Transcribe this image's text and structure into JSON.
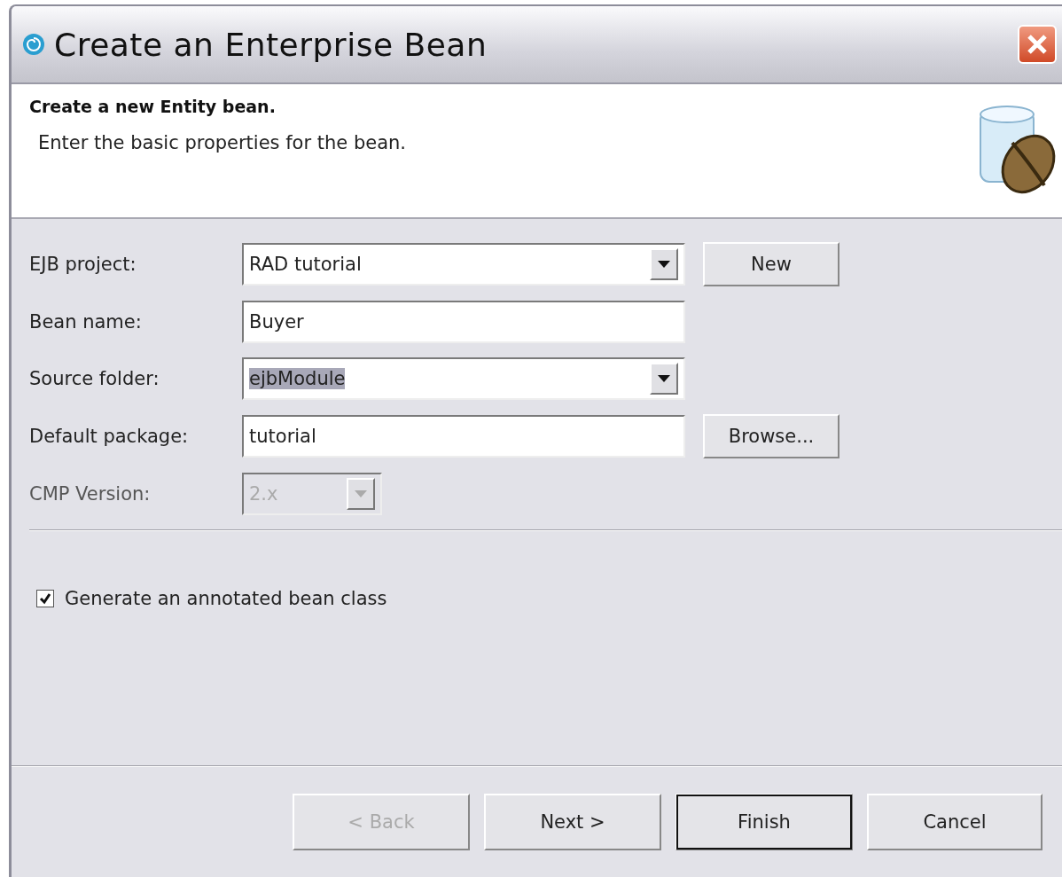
{
  "window": {
    "title": "Create an Enterprise Bean"
  },
  "header": {
    "title": "Create a new Entity bean.",
    "description": "Enter the basic properties for the bean."
  },
  "fields": [
    {
      "kind": "combo",
      "label": "EJB project:",
      "value": "RAD tutorial",
      "disabled": false,
      "highlighted": false,
      "button": "New"
    },
    {
      "kind": "text",
      "label": "Bean name:",
      "value": "Buyer",
      "disabled": false,
      "highlighted": false
    },
    {
      "kind": "combo",
      "label": "Source folder:",
      "value": "ejbModule",
      "disabled": false,
      "highlighted": true
    },
    {
      "kind": "text",
      "label": "Default package:",
      "value": "tutorial",
      "disabled": false,
      "highlighted": false,
      "button": "Browse..."
    },
    {
      "kind": "small-combo",
      "label": "CMP Version:",
      "value": "2.x",
      "disabled": true,
      "highlighted": false
    }
  ],
  "checkbox": {
    "label": "Generate an annotated bean class",
    "checked": true
  },
  "buttons": [
    {
      "label": "< Back",
      "disabled": true,
      "default": false
    },
    {
      "label": "Next >",
      "disabled": false,
      "default": false
    },
    {
      "label": "Finish",
      "disabled": false,
      "default": true
    },
    {
      "label": "Cancel",
      "disabled": false,
      "default": false
    }
  ]
}
